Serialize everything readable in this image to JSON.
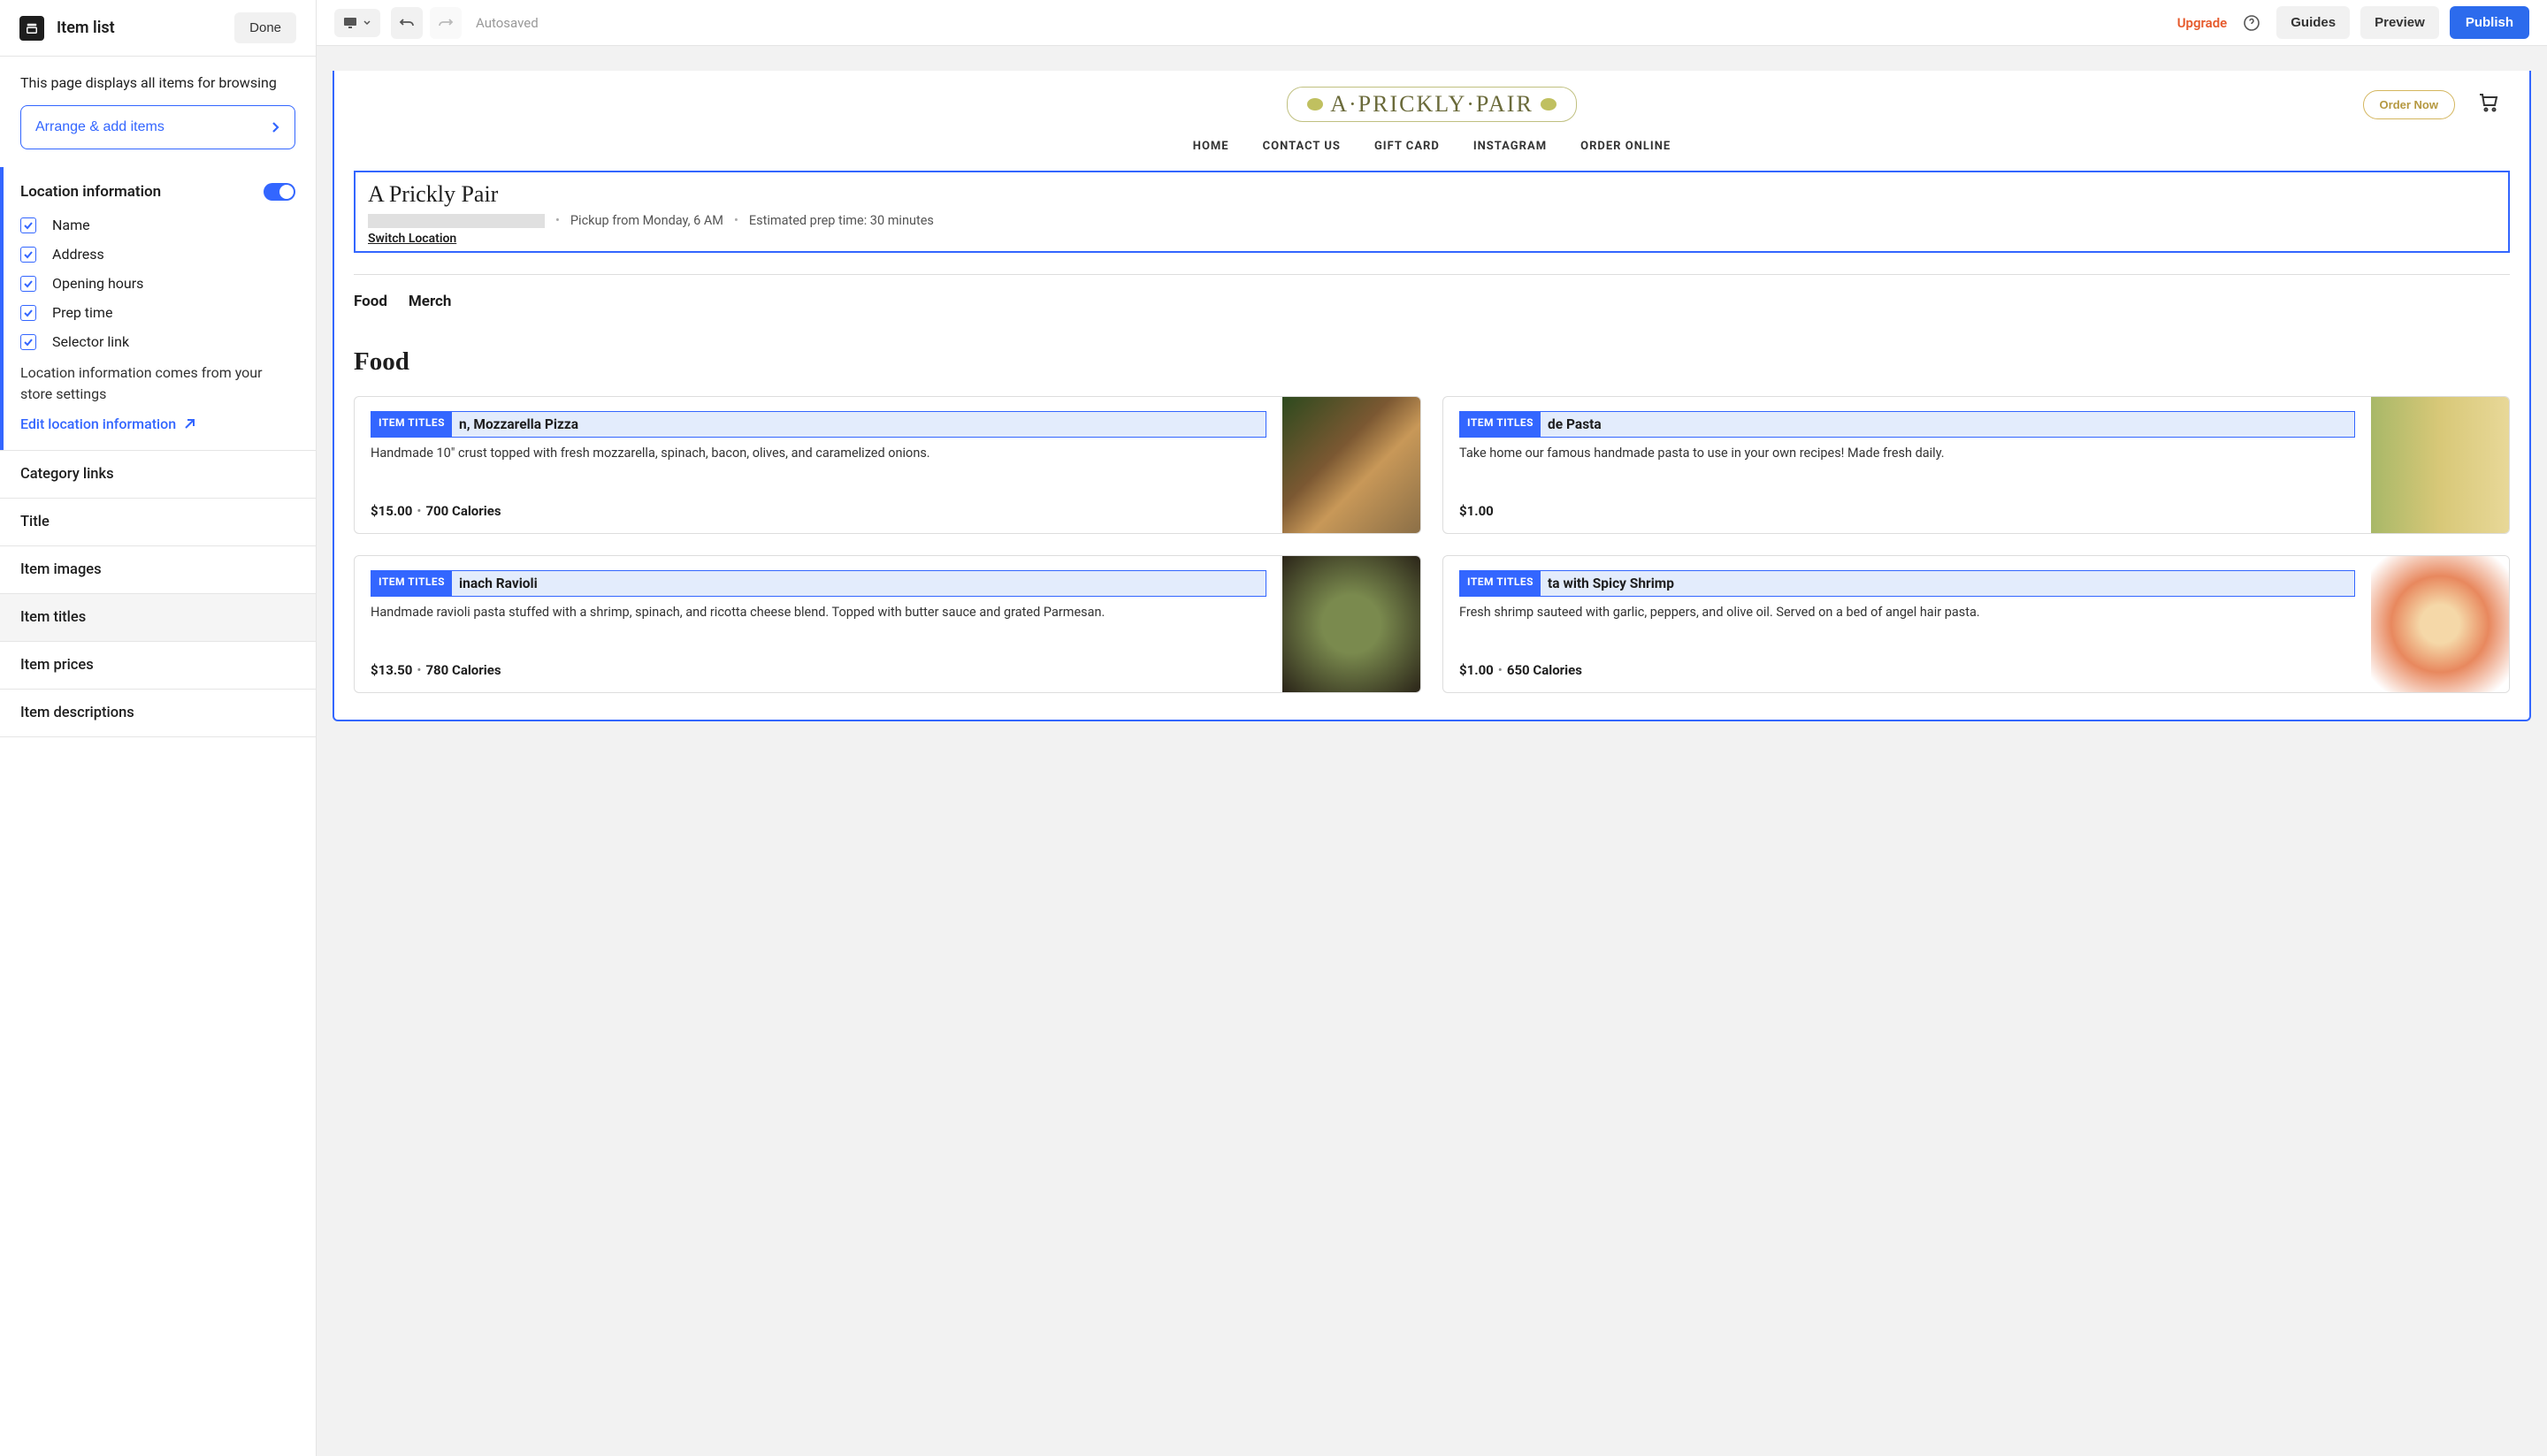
{
  "sidebar": {
    "title": "Item list",
    "done": "Done",
    "description": "This page displays all items for browsing",
    "arrange_btn": "Arrange & add items",
    "location": {
      "heading": "Location information",
      "options": {
        "name": "Name",
        "address": "Address",
        "hours": "Opening hours",
        "prep": "Prep time",
        "selector": "Selector link"
      },
      "helper": "Location information comes from your store settings",
      "edit_link": "Edit location information"
    },
    "accordion": {
      "category_links": "Category links",
      "title": "Title",
      "item_images": "Item images",
      "item_titles": "Item titles",
      "item_prices": "Item prices",
      "item_descriptions": "Item descriptions"
    }
  },
  "toolbar": {
    "autosave": "Autosaved",
    "upgrade": "Upgrade",
    "guides": "Guides",
    "preview": "Preview",
    "publish": "Publish"
  },
  "site": {
    "logo": "A·PRICKLY·PAIR",
    "order_now": "Order Now",
    "nav": {
      "home": "HOME",
      "contact": "CONTACT US",
      "gift": "GIFT CARD",
      "instagram": "INSTAGRAM",
      "order": "ORDER ONLINE"
    },
    "location": {
      "title": "A Prickly Pair",
      "pickup": "Pickup from Monday, 6 AM",
      "prep": "Estimated prep time: 30 minutes",
      "switch": "Switch Location"
    },
    "tabs": {
      "food": "Food",
      "merch": "Merch"
    },
    "section_food": "Food",
    "tag": "ITEM TITLES",
    "items": {
      "pizza": {
        "title": "n, Mozzarella Pizza",
        "desc": "Handmade 10\" crust topped with fresh mozzarella, spinach, bacon, olives, and caramelized onions.",
        "price": "$15.00",
        "cal": "700 Calories"
      },
      "pasta": {
        "title": "de Pasta",
        "desc": "Take home our famous handmade pasta to use in your own recipes! Made fresh daily.",
        "price": "$1.00"
      },
      "ravioli": {
        "title": "inach Ravioli",
        "desc": "Handmade ravioli pasta stuffed with a shrimp, spinach, and ricotta cheese blend. Topped with butter sauce and grated Parmesan.",
        "price": "$13.50",
        "cal": "780 Calories"
      },
      "shrimp": {
        "title": "ta with Spicy Shrimp",
        "desc": "Fresh shrimp sauteed with garlic, peppers, and olive oil. Served on a bed of angel hair pasta.",
        "price": "$1.00",
        "cal": "650 Calories"
      }
    }
  }
}
